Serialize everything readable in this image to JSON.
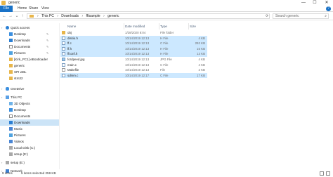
{
  "window": {
    "title": "generic",
    "minimize": "—",
    "maximize": "☐",
    "close": "✕"
  },
  "ribbon": {
    "tabs": [
      "File",
      "Home",
      "Share",
      "View"
    ],
    "help": "?"
  },
  "address": {
    "crumbs": [
      "This PC",
      "Downloads",
      "fftsample",
      "generic"
    ],
    "separator": "›",
    "search_placeholder": "Search generic"
  },
  "nav": {
    "items": [
      {
        "label": "Quick access",
        "icon": "star-icon",
        "level": 0,
        "pinned": false
      },
      {
        "label": "Desktop",
        "icon": "desktop-icon",
        "level": 1,
        "pinned": true
      },
      {
        "label": "Downloads",
        "icon": "download-icon",
        "level": 1,
        "pinned": true
      },
      {
        "label": "Documents",
        "icon": "document-icon",
        "level": 1,
        "pinned": true
      },
      {
        "label": "Pictures",
        "icon": "picture-icon",
        "level": 1,
        "pinned": true
      },
      {
        "label": "[Kirk_PC1] eBootloader",
        "icon": "folder-icon",
        "level": 1,
        "pinned": false
      },
      {
        "label": "generic",
        "icon": "folder-icon",
        "level": 1,
        "pinned": false
      },
      {
        "label": "SPI wBL",
        "icon": "folder-icon",
        "level": 1,
        "pinned": false
      },
      {
        "label": "stm32",
        "icon": "folder-icon",
        "level": 1,
        "pinned": false
      },
      {
        "label": "OneDrive",
        "icon": "cloud-icon",
        "level": 0,
        "pinned": false
      },
      {
        "label": "This PC",
        "icon": "computer-icon",
        "level": 0,
        "pinned": false
      },
      {
        "label": "3D Objects",
        "icon": "cube-icon",
        "level": 1,
        "pinned": false
      },
      {
        "label": "Desktop",
        "icon": "desktop-icon",
        "level": 1,
        "pinned": false
      },
      {
        "label": "Documents",
        "icon": "document-icon",
        "level": 1,
        "pinned": false
      },
      {
        "label": "Downloads",
        "icon": "download-icon",
        "level": 1,
        "pinned": false,
        "selected": true
      },
      {
        "label": "Music",
        "icon": "music-icon",
        "level": 1,
        "pinned": false
      },
      {
        "label": "Pictures",
        "icon": "picture-icon",
        "level": 1,
        "pinned": false
      },
      {
        "label": "Videos",
        "icon": "video-icon",
        "level": 1,
        "pinned": false
      },
      {
        "label": "Local Disk (C:)",
        "icon": "drive-icon",
        "level": 1,
        "pinned": false
      },
      {
        "label": "setup (E:)",
        "icon": "drive-icon",
        "level": 1,
        "pinned": false
      },
      {
        "label": "setup (E:)",
        "icon": "drive-icon",
        "level": 0,
        "pinned": false
      },
      {
        "label": "Network",
        "icon": "network-icon",
        "level": 0,
        "pinned": false
      }
    ]
  },
  "columns": {
    "name": "Name",
    "date": "Date modified",
    "type": "Type",
    "size": "Size"
  },
  "files": [
    {
      "name": "obj",
      "date": "1/28/2020 8:04",
      "type": "File folder",
      "size": "",
      "icon": "folder-icon",
      "selected": false
    },
    {
      "name": "diskio.h",
      "date": "10/14/2019 12:13",
      "type": "H File",
      "size": "4 KB",
      "icon": "h-file-icon",
      "selected": true
    },
    {
      "name": "ff.c",
      "date": "10/14/2019 12:13",
      "type": "C File",
      "size": "292 KB",
      "icon": "c-file-icon",
      "selected": true
    },
    {
      "name": "ff.h",
      "date": "10/14/2019 12:13",
      "type": "H File",
      "size": "15 KB",
      "icon": "h-file-icon",
      "selected": true
    },
    {
      "name": "ffconf.h",
      "date": "10/14/2019 12:13",
      "type": "H File",
      "size": "13 KB",
      "icon": "h-file-icon",
      "selected": true
    },
    {
      "name": "fordpeed.jpg",
      "date": "10/14/2019 12:13",
      "type": "JPG File",
      "size": "4 KB",
      "icon": "image-file-icon",
      "selected": false
    },
    {
      "name": "main.c",
      "date": "10/14/2019 12:13",
      "type": "C File",
      "size": "4 KB",
      "icon": "c-file-icon",
      "selected": false
    },
    {
      "name": "Makefile",
      "date": "10/14/2019 12:13",
      "type": "File",
      "size": "2 KB",
      "icon": "file-icon",
      "selected": false
    },
    {
      "name": "sdmm.c",
      "date": "10/14/2019 12:17",
      "type": "C File",
      "size": "17 KB",
      "icon": "c-file-icon",
      "selected": true
    }
  ],
  "status": {
    "count": "9 items",
    "selected": "5 items selected  259 KB"
  },
  "colors": {
    "accent": "#1a73c8",
    "selection": "#cce8ff",
    "folder": "#e8b64a"
  }
}
